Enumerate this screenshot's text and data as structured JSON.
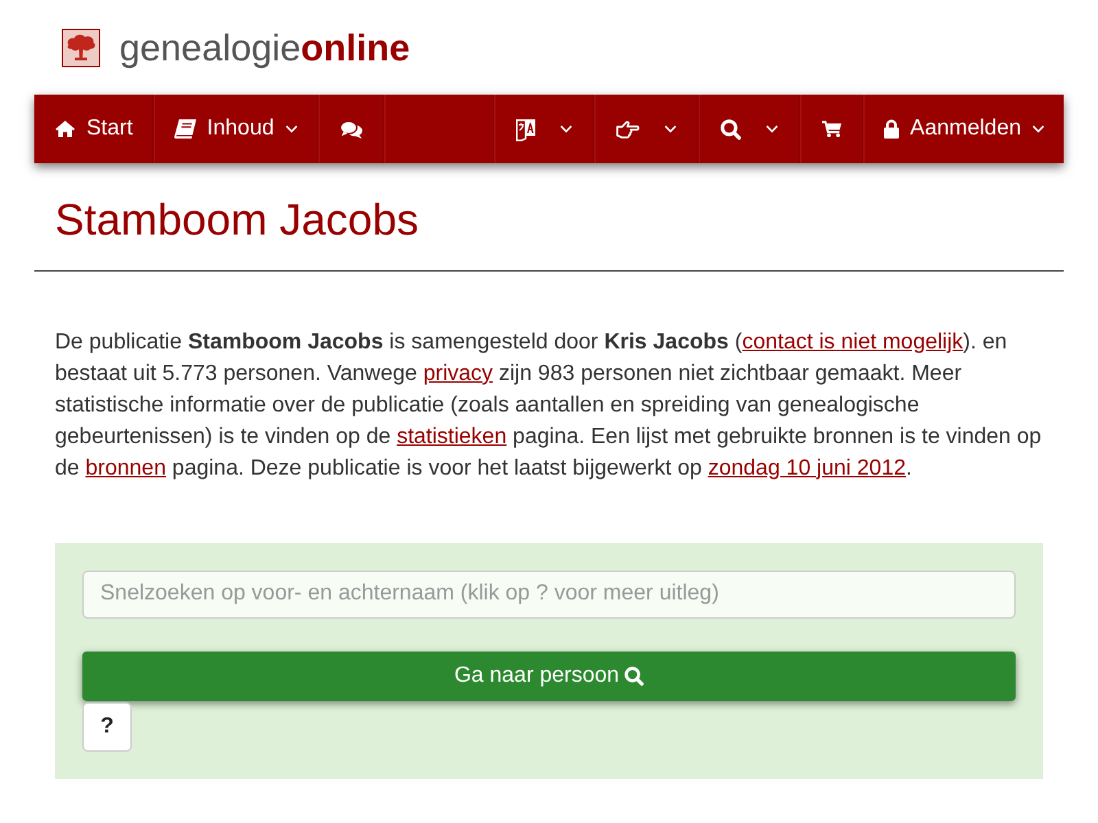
{
  "header": {
    "site_name": "genealogie**online**"
  },
  "nav": {
    "left_items": [
      {
        "label": "Start",
        "dropdown": false
      },
      {
        "label": "Inhoud",
        "dropdown": true
      },
      {
        "dropdown": false
      }
    ],
    "right_items": [
      {
        "dropdown": true
      },
      {
        "dropdown": true
      },
      {
        "dropdown": true
      },
      {
        "dropdown": false
      },
      {
        "label": "Aanmelden",
        "dropdown": true
      }
    ]
  },
  "page": {
    "title": "Stamboom Jacobs",
    "description": [
      {
        "kind": "text",
        "text": "De publicatie **Stamboom Jacobs** is samengesteld door **Kris Jacobs** ("
      },
      {
        "kind": "link",
        "text": "contact is niet mogelijk"
      },
      {
        "kind": "text",
        "text": "). en bestaat uit 5.773 personen. Vanwege "
      },
      {
        "kind": "link",
        "text": "privacy"
      },
      {
        "kind": "text",
        "text": " zijn 983 personen niet zichtbaar gemaakt. Meer statistische informatie over de publicatie (zoals aantallen en spreiding van genealogische gebeurtenissen) is te vinden op de "
      },
      {
        "kind": "link",
        "text": "statistieken"
      },
      {
        "kind": "text",
        "text": " pagina. Een lijst met gebruikte bronnen is te vinden op de "
      },
      {
        "kind": "link",
        "text": "bronnen"
      },
      {
        "kind": "text",
        "text": " pagina. Deze publicatie is voor het laatst bijgewerkt op "
      },
      {
        "kind": "link",
        "text": "zondag 10 juni 2012"
      },
      {
        "kind": "text",
        "text": "."
      }
    ]
  },
  "quick_search": {
    "placeholder": "Snelzoeken op voor- en achternaam (klik op ? voor meer uitleg)",
    "submit_label": "Ga naar persoon",
    "help_label": "?"
  }
}
